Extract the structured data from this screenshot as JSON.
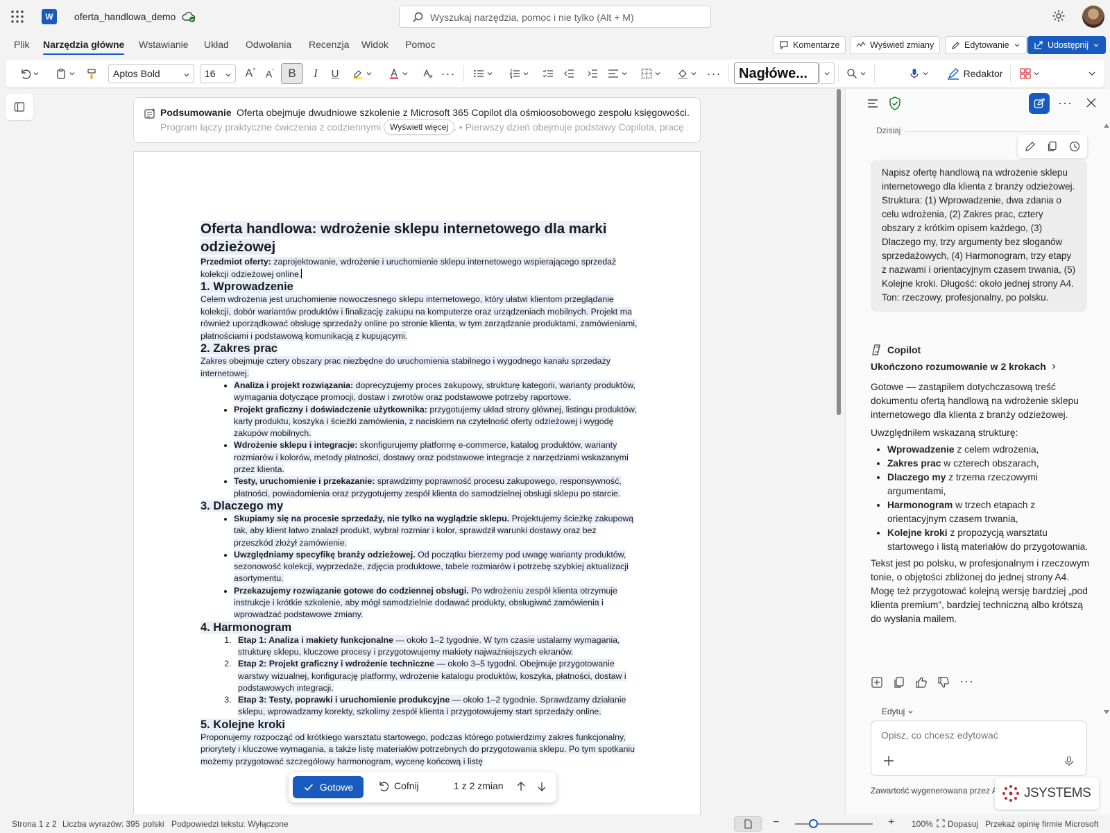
{
  "app": {
    "doc_name": "oferta_handlowa_demo",
    "search_placeholder": "Wyszukaj narzędzia, pomoc i nie tylko (Alt + M)"
  },
  "menu": {
    "tabs": [
      "Plik",
      "Narzędzia główne",
      "Wstawianie",
      "Układ",
      "Odwołania",
      "Recenzja",
      "Widok",
      "Pomoc"
    ],
    "active": "Narzędzia główne",
    "comments_label": "Komentarze",
    "changes_label": "Wyświetl zmiany",
    "editing_label": "Edytowanie",
    "share_label": "Udostępnij"
  },
  "ribbon": {
    "font_name": "Aptos Bold",
    "font_size": "16",
    "style_name": "Nagłówe...",
    "editor_label": "Redaktor"
  },
  "summary": {
    "title": "Podsumowanie",
    "text": "Oferta obejmuje dwudniowe szkolenie z Microsoft 365 Copilot dla ośmioosobowego zespołu księgowości.",
    "text2": "Program łączy praktyczne ćwiczenia z codziennymi zadaniami pracy. • Pierwszy dzień obejmuje podstawy Copilota, pracę z dokumentami",
    "show_more": "Wyświetl więcej"
  },
  "doc": {
    "title": "Oferta handlowa: wdrożenie sklepu internetowego dla marki odzieżowej",
    "subject_label": "Przedmiot oferty:",
    "subject_text": " zaprojektowanie, wdrożenie i uruchomienie sklepu internetowego wspierającego sprzedaż kolekcji odzieżowej online.",
    "s1_title": "1. Wprowadzenie",
    "s1_text": "Celem wdrożenia jest uruchomienie nowoczesnego sklepu internetowego, który ułatwi klientom przeglądanie kolekcji, dobór wariantów produktów i finalizację zakupu na komputerze oraz urządzeniach mobilnych. Projekt ma również uporządkować obsługę sprzedaży online po stronie klienta, w tym zarządzanie produktami, zamówieniami, płatnościami i podstawową komunikacją z kupującymi.",
    "s2_title": "2. Zakres prac",
    "s2_text": "Zakres obejmuje cztery obszary prac niezbędne do uruchomienia stabilnego i wygodnego kanału sprzedaży internetowej.",
    "s2_items": [
      {
        "b": "Analiza i projekt rozwiązania:",
        "t": " doprecyzujemy proces zakupowy, strukturę kategorii, warianty produktów, wymagania dotyczące promocji, dostaw i zwrotów oraz podstawowe potrzeby raportowe."
      },
      {
        "b": "Projekt graficzny i doświadczenie użytkownika:",
        "t": " przygotujemy układ strony głównej, listingu produktów, karty produktu, koszyka i ścieżki zamówienia, z naciskiem na czytelność oferty odzieżowej i wygodę zakupów mobilnych."
      },
      {
        "b": "Wdrożenie sklepu i integracje:",
        "t": " skonfigurujemy platformę e-commerce, katalog produktów, warianty rozmiarów i kolorów, metody płatności, dostawy oraz podstawowe integracje z narzędziami wskazanymi przez klienta."
      },
      {
        "b": "Testy, uruchomienie i przekazanie:",
        "t": " sprawdzimy poprawność procesu zakupowego, responsywność, płatności, powiadomienia oraz przygotujemy zespół klienta do samodzielnej obsługi sklepu po starcie."
      }
    ],
    "s3_title": "3. Dlaczego my",
    "s3_items": [
      {
        "b": "Skupiamy się na procesie sprzedaży, nie tylko na wyglądzie sklepu.",
        "t": " Projektujemy ścieżkę zakupową tak, aby klient łatwo znalazł produkt, wybrał rozmiar i kolor, sprawdził warunki dostawy oraz bez przeszkód złożył zamówienie."
      },
      {
        "b": "Uwzględniamy specyfikę branży odzieżowej.",
        "t": " Od początku bierzemy pod uwagę warianty produktów, sezonowość kolekcji, wyprzedaże, zdjęcia produktowe, tabele rozmiarów i potrzebę szybkiej aktualizacji asortymentu."
      },
      {
        "b": "Przekazujemy rozwiązanie gotowe do codziennej obsługi.",
        "t": " Po wdrożeniu zespół klienta otrzymuje instrukcje i krótkie szkolenie, aby mógł samodzielnie dodawać produkty, obsługiwać zamówienia i wprowadzać podstawowe zmiany."
      }
    ],
    "s4_title": "4. Harmonogram",
    "s4_items": [
      {
        "b": "Etap 1: Analiza i makiety funkcjonalne",
        "t": " — około 1–2 tygodnie. W tym czasie ustalamy wymagania, strukturę sklepu, kluczowe procesy i przygotowujemy makiety najważniejszych ekranów."
      },
      {
        "b": "Etap 2: Projekt graficzny i wdrożenie techniczne",
        "t": " — około 3–5 tygodni. Obejmuje przygotowanie warstwy wizualnej, konfigurację platformy, wdrożenie katalogu produktów, koszyka, płatności, dostaw i podstawowych integracji."
      },
      {
        "b": "Etap 3: Testy, poprawki i uruchomienie produkcyjne",
        "t": " — około 1–2 tygodnie. Sprawdzamy działanie sklepu, wprowadzamy korekty, szkolimy zespół klienta i przygotowujemy start sprzedaży online."
      }
    ],
    "s5_title": "5. Kolejne kroki",
    "s5_text": "Proponujemy rozpocząć od krótkiego warsztatu startowego, podczas którego potwierdzimy zakres funkcjonalny, priorytety i kluczowe wymagania, a także listę materiałów potrzebnych do przygotowania sklepu. Po tym spotkaniu możemy przygotować szczegółowy harmonogram, wycenę końcową i listę"
  },
  "review": {
    "done": "Gotowe",
    "undo": "Cofnij",
    "count": "1 z 2 zmian"
  },
  "copilot": {
    "today": "Dzisiaj",
    "user_msg": "Napisz ofertę handlową na wdrożenie sklepu internetowego dla klienta z branży odzieżowej. Struktura: (1) Wprowadzenie, dwa zdania o celu wdrożenia, (2) Zakres prac, cztery obszary z krótkim opisem każdego, (3) Dlaczego my, trzy argumenty bez sloganów sprzedażowych, (4) Harmonogram, trzy etapy z nazwami i orientacyjnym czasem trwania, (5) Kolejne kroki. Długość: około jednej strony A4. Ton: rzeczowy, profesjonalny, po polsku.",
    "name": "Copilot",
    "reasoning": "Ukończono rozumowanie w 2 krokach",
    "p1": "Gotowe — zastąpiłem dotychczasową treść dokumentu ofertą handlową na wdrożenie sklepu internetowego dla klienta z branży odzieżowej.",
    "p2": "Uwzględniłem wskazaną strukturę:",
    "items": [
      {
        "b": "Wprowadzenie",
        "t": " z celem wdrożenia,"
      },
      {
        "b": "Zakres prac",
        "t": " w czterech obszarach,"
      },
      {
        "b": "Dlaczego my",
        "t": " z trzema rzeczowymi argumentami,"
      },
      {
        "b": "Harmonogram",
        "t": " w trzech etapach z orientacyjnym czasem trwania,"
      },
      {
        "b": "Kolejne kroki",
        "t": " z propozycją warsztatu startowego i listą materiałów do przygotowania."
      }
    ],
    "p3": "Tekst jest po polsku, w profesjonalnym i rzeczowym tonie, o objętości zbliżonej do jednej strony A4.",
    "p4": "Mogę też przygotować kolejną wersję bardziej „pod klienta premium”, bardziej techniczną albo krótszą do wysłania mailem.",
    "edit_mode": "Edytuj",
    "input_placeholder": "Opisz, co chcesz edytować",
    "disclaimer": "Zawartość wygenerowana przez A",
    "watermark": "JSYSTEMS"
  },
  "status": {
    "page": "Strona 1 z 2",
    "words": "Liczba wyrazów: 395",
    "lang": "polski",
    "text_pred": "Podpowiedzi tekstu: Wyłączone",
    "zoom": "100%",
    "fit": "Dopasuj",
    "feedback": "Przekaż opinię firmie Microsoft"
  },
  "colors": {
    "accent": "#185abd",
    "highlight": "#e9eef8"
  }
}
